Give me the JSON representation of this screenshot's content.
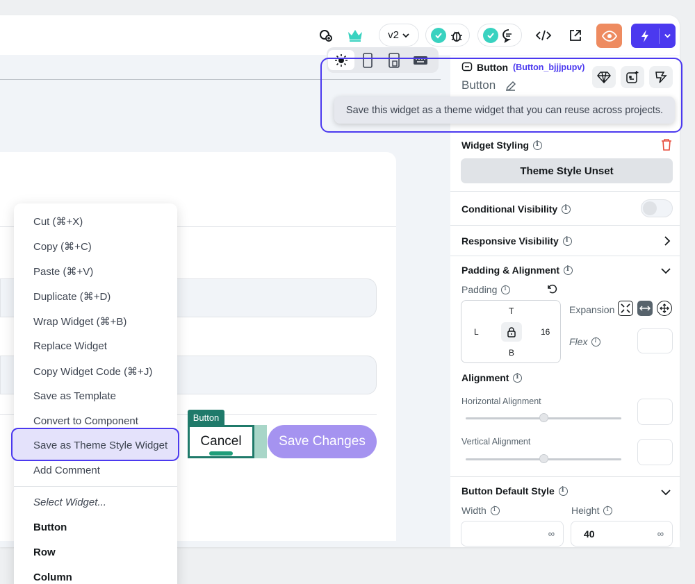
{
  "topbar": {
    "version_label": "v2"
  },
  "context_menu": {
    "items": [
      "Cut (⌘+X)",
      "Copy (⌘+C)",
      "Paste (⌘+V)",
      "Duplicate (⌘+D)",
      "Wrap Widget (⌘+B)",
      "Replace Widget",
      "Copy Widget Code (⌘+J)",
      "Save as Template",
      "Convert to Component",
      "Save as Theme Style Widget",
      "Add Comment"
    ],
    "select_header": "Select Widget...",
    "select_items": [
      "Button",
      "Row",
      "Column"
    ]
  },
  "canvas": {
    "widget_tag": "Button",
    "cancel_label": "Cancel",
    "save_label": "Save Changes"
  },
  "panel": {
    "widget_type": "Button",
    "widget_id": "(Button_bjjjpupv)",
    "widget_name": "Button",
    "tooltip": "Save this widget as a theme widget that you can reuse across projects.",
    "widget_styling": "Widget Styling",
    "theme_style_unset": "Theme Style Unset",
    "conditional_visibility": "Conditional Visibility",
    "responsive_visibility": "Responsive Visibility",
    "padding_alignment": "Padding & Alignment",
    "padding": "Padding",
    "pad_top": "T",
    "pad_left": "L",
    "pad_right": "16",
    "pad_bottom": "B",
    "expansion": "Expansion",
    "flex": "Flex",
    "alignment": "Alignment",
    "horizontal_alignment": "Horizontal Alignment",
    "vertical_alignment": "Vertical Alignment",
    "button_default_style": "Button Default Style",
    "width_label": "Width",
    "height_label": "Height",
    "width_value": "∞",
    "height_value": "40",
    "height_unit": "∞"
  },
  "colors": {
    "primary": "#4b39ef",
    "teal": "#39d2c0",
    "orange_preview": "#ee8b60",
    "save_button": "#a593f0",
    "widget_tag": "#1f7a6a",
    "delete_red": "#e74c3c"
  }
}
